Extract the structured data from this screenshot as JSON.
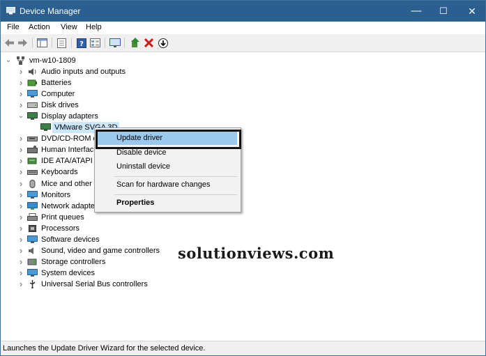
{
  "window": {
    "title": "Device Manager",
    "minimize": "—",
    "maximize": "☐",
    "close": "✕"
  },
  "menu": {
    "items": [
      "File",
      "Action",
      "View",
      "Help"
    ]
  },
  "tree": {
    "root": "vm-w10-1809",
    "nodes": [
      {
        "label": "Audio inputs and outputs",
        "icon": "speaker-icon"
      },
      {
        "label": "Batteries",
        "icon": "battery-icon"
      },
      {
        "label": "Computer",
        "icon": "computer-icon"
      },
      {
        "label": "Disk drives",
        "icon": "disk-drive-icon"
      },
      {
        "label": "Display adapters",
        "icon": "display-adapter-icon",
        "expanded": true,
        "children": [
          {
            "label": "VMware SVGA 3D",
            "selected": true
          }
        ]
      },
      {
        "label": "DVD/CD-ROM d",
        "icon": "dvd-drive-icon"
      },
      {
        "label": "Human Interfac",
        "icon": "keyboard-hid-icon"
      },
      {
        "label": "IDE ATA/ATAPI c",
        "icon": "ide-controller-icon"
      },
      {
        "label": "Keyboards",
        "icon": "keyboard-icon"
      },
      {
        "label": "Mice and other p",
        "icon": "mouse-icon"
      },
      {
        "label": "Monitors",
        "icon": "monitor-icon"
      },
      {
        "label": "Network adapte",
        "icon": "network-adapter-icon"
      },
      {
        "label": "Print queues",
        "icon": "printer-icon"
      },
      {
        "label": "Processors",
        "icon": "processor-icon"
      },
      {
        "label": "Software devices",
        "icon": "software-device-icon"
      },
      {
        "label": "Sound, video and game controllers",
        "icon": "sound-icon"
      },
      {
        "label": "Storage controllers",
        "icon": "storage-controller-icon"
      },
      {
        "label": "System devices",
        "icon": "system-device-icon"
      },
      {
        "label": "Universal Serial Bus controllers",
        "icon": "usb-icon"
      }
    ]
  },
  "context_menu": {
    "items": [
      {
        "label": "Update driver",
        "highlighted": true
      },
      {
        "label": "Disable device"
      },
      {
        "label": "Uninstall device"
      },
      {
        "label": "Scan for hardware changes"
      },
      {
        "label": "Properties",
        "bold": true
      }
    ]
  },
  "watermark": "solutionviews.com",
  "status_bar": {
    "text": "Launches the Update Driver Wizard for the selected device."
  },
  "colors": {
    "titlebar": "#2b5f8f",
    "highlight": "#99c9ef",
    "selected": "#cce8ff"
  }
}
